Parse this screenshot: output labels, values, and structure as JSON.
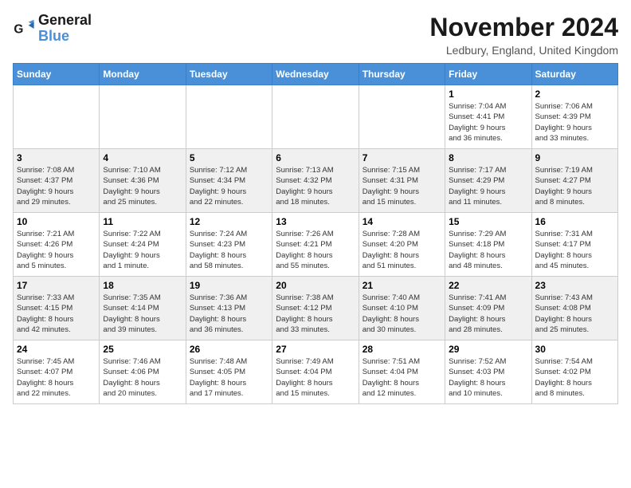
{
  "logo": {
    "line1": "General",
    "line2": "Blue"
  },
  "title": "November 2024",
  "location": "Ledbury, England, United Kingdom",
  "days_of_week": [
    "Sunday",
    "Monday",
    "Tuesday",
    "Wednesday",
    "Thursday",
    "Friday",
    "Saturday"
  ],
  "weeks": [
    [
      {
        "day": "",
        "info": ""
      },
      {
        "day": "",
        "info": ""
      },
      {
        "day": "",
        "info": ""
      },
      {
        "day": "",
        "info": ""
      },
      {
        "day": "",
        "info": ""
      },
      {
        "day": "1",
        "info": "Sunrise: 7:04 AM\nSunset: 4:41 PM\nDaylight: 9 hours\nand 36 minutes."
      },
      {
        "day": "2",
        "info": "Sunrise: 7:06 AM\nSunset: 4:39 PM\nDaylight: 9 hours\nand 33 minutes."
      }
    ],
    [
      {
        "day": "3",
        "info": "Sunrise: 7:08 AM\nSunset: 4:37 PM\nDaylight: 9 hours\nand 29 minutes."
      },
      {
        "day": "4",
        "info": "Sunrise: 7:10 AM\nSunset: 4:36 PM\nDaylight: 9 hours\nand 25 minutes."
      },
      {
        "day": "5",
        "info": "Sunrise: 7:12 AM\nSunset: 4:34 PM\nDaylight: 9 hours\nand 22 minutes."
      },
      {
        "day": "6",
        "info": "Sunrise: 7:13 AM\nSunset: 4:32 PM\nDaylight: 9 hours\nand 18 minutes."
      },
      {
        "day": "7",
        "info": "Sunrise: 7:15 AM\nSunset: 4:31 PM\nDaylight: 9 hours\nand 15 minutes."
      },
      {
        "day": "8",
        "info": "Sunrise: 7:17 AM\nSunset: 4:29 PM\nDaylight: 9 hours\nand 11 minutes."
      },
      {
        "day": "9",
        "info": "Sunrise: 7:19 AM\nSunset: 4:27 PM\nDaylight: 9 hours\nand 8 minutes."
      }
    ],
    [
      {
        "day": "10",
        "info": "Sunrise: 7:21 AM\nSunset: 4:26 PM\nDaylight: 9 hours\nand 5 minutes."
      },
      {
        "day": "11",
        "info": "Sunrise: 7:22 AM\nSunset: 4:24 PM\nDaylight: 9 hours\nand 1 minute."
      },
      {
        "day": "12",
        "info": "Sunrise: 7:24 AM\nSunset: 4:23 PM\nDaylight: 8 hours\nand 58 minutes."
      },
      {
        "day": "13",
        "info": "Sunrise: 7:26 AM\nSunset: 4:21 PM\nDaylight: 8 hours\nand 55 minutes."
      },
      {
        "day": "14",
        "info": "Sunrise: 7:28 AM\nSunset: 4:20 PM\nDaylight: 8 hours\nand 51 minutes."
      },
      {
        "day": "15",
        "info": "Sunrise: 7:29 AM\nSunset: 4:18 PM\nDaylight: 8 hours\nand 48 minutes."
      },
      {
        "day": "16",
        "info": "Sunrise: 7:31 AM\nSunset: 4:17 PM\nDaylight: 8 hours\nand 45 minutes."
      }
    ],
    [
      {
        "day": "17",
        "info": "Sunrise: 7:33 AM\nSunset: 4:15 PM\nDaylight: 8 hours\nand 42 minutes."
      },
      {
        "day": "18",
        "info": "Sunrise: 7:35 AM\nSunset: 4:14 PM\nDaylight: 8 hours\nand 39 minutes."
      },
      {
        "day": "19",
        "info": "Sunrise: 7:36 AM\nSunset: 4:13 PM\nDaylight: 8 hours\nand 36 minutes."
      },
      {
        "day": "20",
        "info": "Sunrise: 7:38 AM\nSunset: 4:12 PM\nDaylight: 8 hours\nand 33 minutes."
      },
      {
        "day": "21",
        "info": "Sunrise: 7:40 AM\nSunset: 4:10 PM\nDaylight: 8 hours\nand 30 minutes."
      },
      {
        "day": "22",
        "info": "Sunrise: 7:41 AM\nSunset: 4:09 PM\nDaylight: 8 hours\nand 28 minutes."
      },
      {
        "day": "23",
        "info": "Sunrise: 7:43 AM\nSunset: 4:08 PM\nDaylight: 8 hours\nand 25 minutes."
      }
    ],
    [
      {
        "day": "24",
        "info": "Sunrise: 7:45 AM\nSunset: 4:07 PM\nDaylight: 8 hours\nand 22 minutes."
      },
      {
        "day": "25",
        "info": "Sunrise: 7:46 AM\nSunset: 4:06 PM\nDaylight: 8 hours\nand 20 minutes."
      },
      {
        "day": "26",
        "info": "Sunrise: 7:48 AM\nSunset: 4:05 PM\nDaylight: 8 hours\nand 17 minutes."
      },
      {
        "day": "27",
        "info": "Sunrise: 7:49 AM\nSunset: 4:04 PM\nDaylight: 8 hours\nand 15 minutes."
      },
      {
        "day": "28",
        "info": "Sunrise: 7:51 AM\nSunset: 4:04 PM\nDaylight: 8 hours\nand 12 minutes."
      },
      {
        "day": "29",
        "info": "Sunrise: 7:52 AM\nSunset: 4:03 PM\nDaylight: 8 hours\nand 10 minutes."
      },
      {
        "day": "30",
        "info": "Sunrise: 7:54 AM\nSunset: 4:02 PM\nDaylight: 8 hours\nand 8 minutes."
      }
    ]
  ]
}
